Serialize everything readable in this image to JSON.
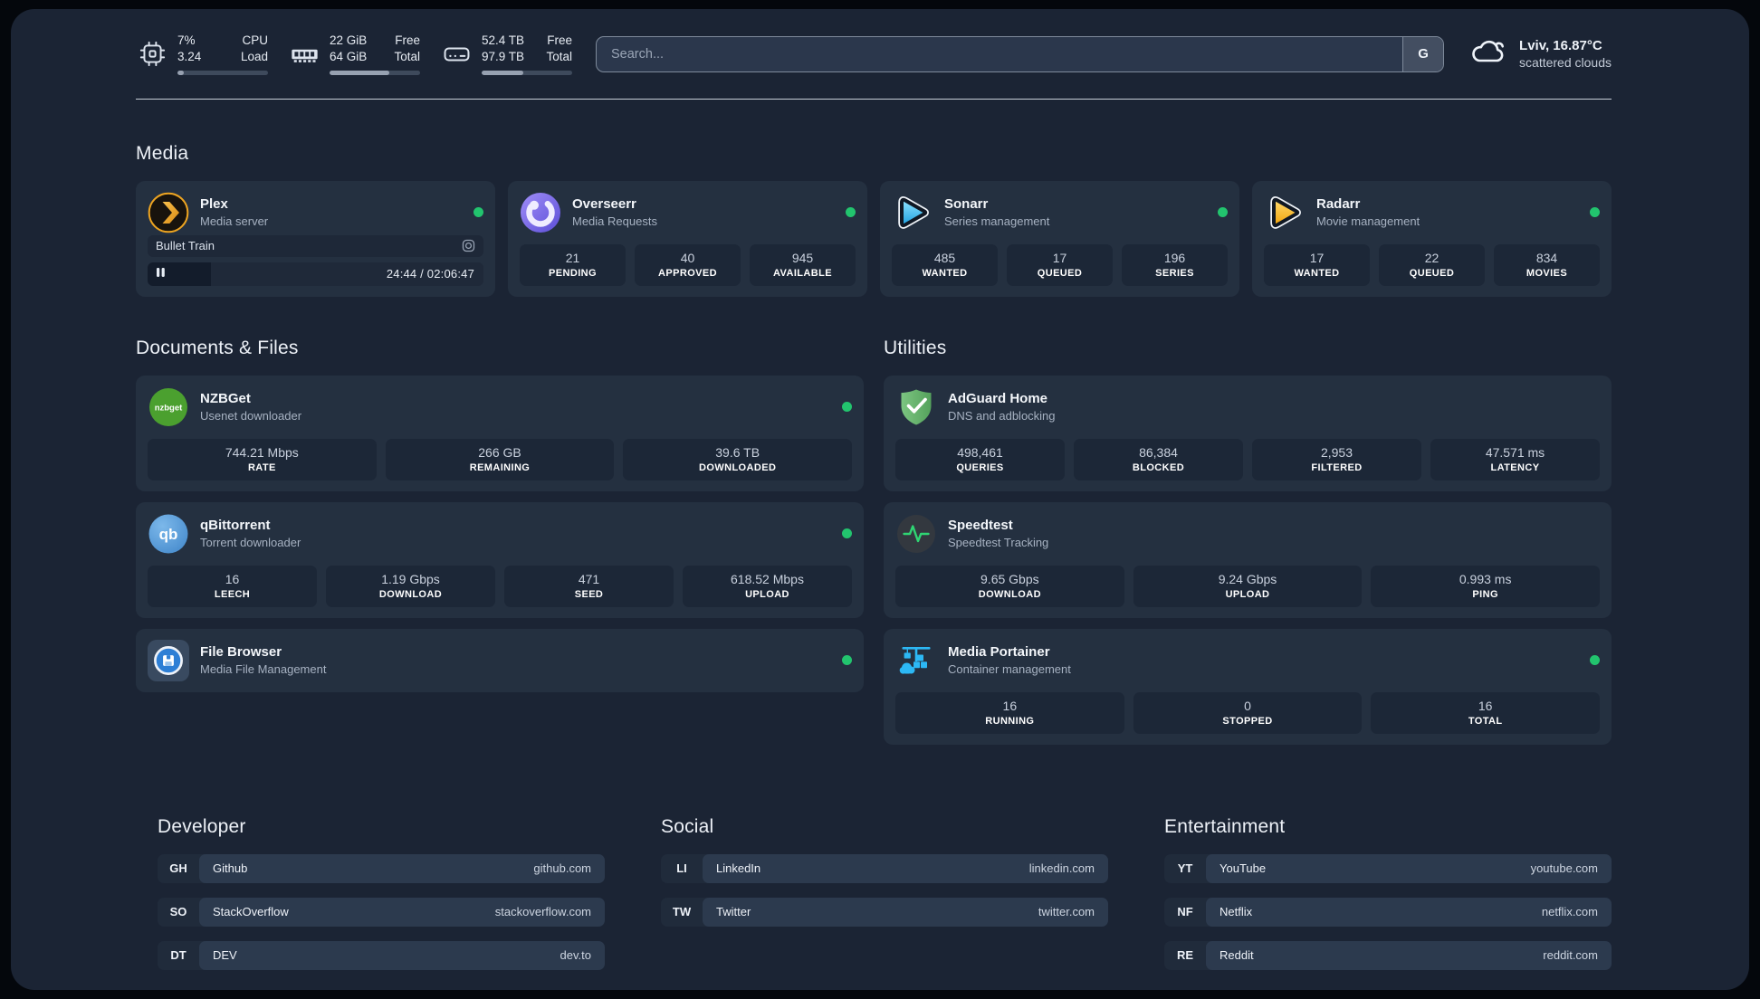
{
  "header": {
    "system": [
      {
        "value_line1": "7%",
        "value_line2": "3.24",
        "label_line1": "CPU",
        "label_line2": "Load",
        "progress_pct": 7
      },
      {
        "value_line1": "22 GiB",
        "value_line2": "64 GiB",
        "label_line1": "Free",
        "label_line2": "Total",
        "progress_pct": 66
      },
      {
        "value_line1": "52.4 TB",
        "value_line2": "97.9 TB",
        "label_line1": "Free",
        "label_line2": "Total",
        "progress_pct": 46
      }
    ],
    "search": {
      "placeholder": "Search...",
      "provider_label": "G"
    },
    "weather": {
      "location_temp": "Lviv, 16.87°C",
      "condition": "scattered clouds"
    }
  },
  "sections": {
    "media": {
      "title": "Media",
      "plex": {
        "name": "Plex",
        "subtitle": "Media server",
        "now_playing": {
          "title": "Bullet Train",
          "time_display": "24:44 / 02:06:47",
          "progress_pct": 19
        }
      },
      "overseerr": {
        "name": "Overseerr",
        "subtitle": "Media Requests",
        "stats": [
          {
            "value": "21",
            "label": "PENDING"
          },
          {
            "value": "40",
            "label": "APPROVED"
          },
          {
            "value": "945",
            "label": "AVAILABLE"
          }
        ]
      },
      "sonarr": {
        "name": "Sonarr",
        "subtitle": "Series management",
        "stats": [
          {
            "value": "485",
            "label": "WANTED"
          },
          {
            "value": "17",
            "label": "QUEUED"
          },
          {
            "value": "196",
            "label": "SERIES"
          }
        ]
      },
      "radarr": {
        "name": "Radarr",
        "subtitle": "Movie management",
        "stats": [
          {
            "value": "17",
            "label": "WANTED"
          },
          {
            "value": "22",
            "label": "QUEUED"
          },
          {
            "value": "834",
            "label": "MOVIES"
          }
        ]
      }
    },
    "documents": {
      "title": "Documents & Files",
      "nzbget": {
        "name": "NZBGet",
        "subtitle": "Usenet downloader",
        "stats": [
          {
            "value": "744.21 Mbps",
            "label": "RATE"
          },
          {
            "value": "266 GB",
            "label": "REMAINING"
          },
          {
            "value": "39.6 TB",
            "label": "DOWNLOADED"
          }
        ]
      },
      "qbittorrent": {
        "name": "qBittorrent",
        "subtitle": "Torrent downloader",
        "stats": [
          {
            "value": "16",
            "label": "LEECH"
          },
          {
            "value": "1.19 Gbps",
            "label": "DOWNLOAD"
          },
          {
            "value": "471",
            "label": "SEED"
          },
          {
            "value": "618.52 Mbps",
            "label": "UPLOAD"
          }
        ]
      },
      "filebrowser": {
        "name": "File Browser",
        "subtitle": "Media File Management"
      }
    },
    "utilities": {
      "title": "Utilities",
      "adguard": {
        "name": "AdGuard Home",
        "subtitle": "DNS and adblocking",
        "stats": [
          {
            "value": "498,461",
            "label": "QUERIES"
          },
          {
            "value": "86,384",
            "label": "BLOCKED"
          },
          {
            "value": "2,953",
            "label": "FILTERED"
          },
          {
            "value": "47.571 ms",
            "label": "LATENCY"
          }
        ]
      },
      "speedtest": {
        "name": "Speedtest",
        "subtitle": "Speedtest Tracking",
        "stats": [
          {
            "value": "9.65 Gbps",
            "label": "DOWNLOAD"
          },
          {
            "value": "9.24 Gbps",
            "label": "UPLOAD"
          },
          {
            "value": "0.993 ms",
            "label": "PING"
          }
        ]
      },
      "portainer": {
        "name": "Media Portainer",
        "subtitle": "Container management",
        "stats": [
          {
            "value": "16",
            "label": "RUNNING"
          },
          {
            "value": "0",
            "label": "STOPPED"
          },
          {
            "value": "16",
            "label": "TOTAL"
          }
        ]
      }
    },
    "links": {
      "developer": {
        "title": "Developer",
        "items": [
          {
            "abbr": "GH",
            "name": "Github",
            "url": "github.com"
          },
          {
            "abbr": "SO",
            "name": "StackOverflow",
            "url": "stackoverflow.com"
          },
          {
            "abbr": "DT",
            "name": "DEV",
            "url": "dev.to"
          }
        ]
      },
      "social": {
        "title": "Social",
        "items": [
          {
            "abbr": "LI",
            "name": "LinkedIn",
            "url": "linkedin.com"
          },
          {
            "abbr": "TW",
            "name": "Twitter",
            "url": "twitter.com"
          }
        ]
      },
      "entertainment": {
        "title": "Entertainment",
        "items": [
          {
            "abbr": "YT",
            "name": "YouTube",
            "url": "youtube.com"
          },
          {
            "abbr": "NF",
            "name": "Netflix",
            "url": "netflix.com"
          },
          {
            "abbr": "RE",
            "name": "Reddit",
            "url": "reddit.com"
          }
        ]
      }
    }
  },
  "colors": {
    "status_online": "#22c46e",
    "plex_accent": "#e5a00d",
    "sonarr_accent": "#35c5f4",
    "radarr_accent": "#ffc230",
    "adguard_accent": "#67b879",
    "portainer_accent": "#2cb8f5",
    "speedtest_pulse": "#2fd573"
  }
}
